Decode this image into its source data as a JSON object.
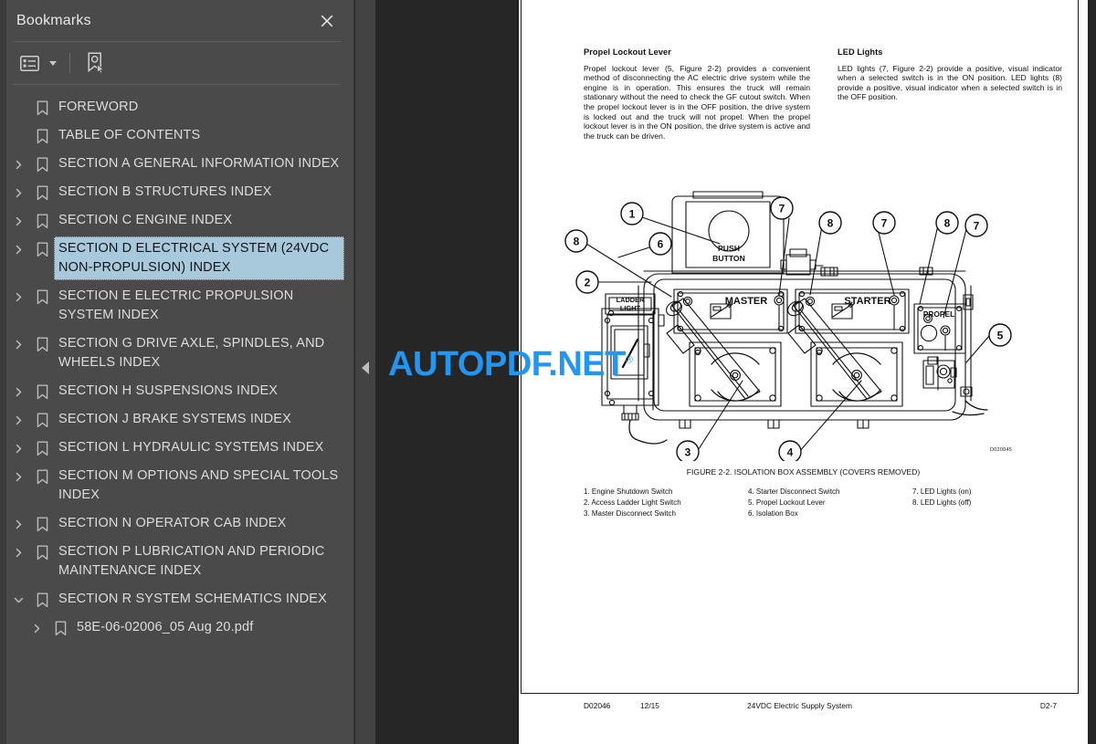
{
  "sidebar": {
    "title": "Bookmarks",
    "close_icon": "close-icon",
    "toolbar": {
      "options_icon": "list-options-icon",
      "dropdown_icon": "chevron-down-icon",
      "new_bookmark_icon": "new-bookmark-icon"
    },
    "items": [
      {
        "label": "FOREWORD",
        "twisty": "none",
        "depth": 0,
        "selected": false
      },
      {
        "label": "TABLE OF CONTENTS",
        "twisty": "none",
        "depth": 0,
        "selected": false
      },
      {
        "label": "SECTION A GENERAL INFORMATION INDEX",
        "twisty": "collapsed",
        "depth": 0,
        "selected": false
      },
      {
        "label": "SECTION B STRUCTURES INDEX",
        "twisty": "collapsed",
        "depth": 0,
        "selected": false
      },
      {
        "label": "SECTION C ENGINE INDEX",
        "twisty": "collapsed",
        "depth": 0,
        "selected": false
      },
      {
        "label": "SECTION D ELECTRICAL SYSTEM (24VDC NON-PROPULSION) INDEX",
        "twisty": "collapsed",
        "depth": 0,
        "selected": true
      },
      {
        "label": "SECTION E ELECTRIC PROPULSION SYSTEM INDEX",
        "twisty": "collapsed",
        "depth": 0,
        "selected": false
      },
      {
        "label": "SECTION G DRIVE AXLE, SPINDLES, AND WHEELS INDEX",
        "twisty": "collapsed",
        "depth": 0,
        "selected": false
      },
      {
        "label": "SECTION H SUSPENSIONS INDEX",
        "twisty": "collapsed",
        "depth": 0,
        "selected": false
      },
      {
        "label": "SECTION J BRAKE SYSTEMS INDEX",
        "twisty": "collapsed",
        "depth": 0,
        "selected": false
      },
      {
        "label": "SECTION L HYDRAULIC SYSTEMS INDEX",
        "twisty": "collapsed",
        "depth": 0,
        "selected": false
      },
      {
        "label": "SECTION M OPTIONS AND SPECIAL TOOLS INDEX",
        "twisty": "collapsed",
        "depth": 0,
        "selected": false
      },
      {
        "label": "SECTION N OPERATOR CAB INDEX",
        "twisty": "collapsed",
        "depth": 0,
        "selected": false
      },
      {
        "label": "SECTION P LUBRICATION AND PERIODIC MAINTENANCE INDEX",
        "twisty": "collapsed",
        "depth": 0,
        "selected": false
      },
      {
        "label": "SECTION R SYSTEM SCHEMATICS INDEX",
        "twisty": "expanded",
        "depth": 0,
        "selected": false
      },
      {
        "label": "58E-06-02006_05 Aug 20.pdf",
        "twisty": "collapsed",
        "depth": 1,
        "selected": false
      }
    ],
    "selection_color": "#a8c8dc"
  },
  "splitter": {
    "collapse_icon": "triangle-left-icon"
  },
  "watermark": {
    "text": "AUTOPDF.NET",
    "mark": "®",
    "color": "#2196f3"
  },
  "document": {
    "columns": [
      {
        "heading": "Propel Lockout Lever",
        "body": "Propel lockout lever (5, Figure 2-2) provides a convenient method of disconnecting the AC electric drive system while the engine is in operation. This ensures the truck will remain stationary without the need to check the GF cutout switch. When the propel lockout lever is in the OFF position, the drive system is locked out and the truck will not propel. When the propel lockout lever is in the ON position, the drive system is active and the truck can be driven."
      },
      {
        "heading": "LED Lights",
        "body": "LED lights (7, Figure 2-2) provide a positive, visual indicator when a selected switch is in the ON position. LED lights (8) provide a positive, visual indicator when a selected switch is in the OFF position."
      }
    ],
    "figure": {
      "caption": "FIGURE 2-2. ISOLATION BOX ASSEMBLY (COVERS REMOVED)",
      "drawing_id": "D020045",
      "labels": {
        "push_button": "PUSH\nBUTTON",
        "push_button_line1": "PUSH",
        "push_button_line2": "BUTTON",
        "ladder_light_line1": "LADDER",
        "ladder_light_line2": "LIGHT",
        "master": "MASTER",
        "starter": "STARTER",
        "propel": "PROPEL"
      },
      "callouts": [
        "1",
        "2",
        "3",
        "4",
        "5",
        "6",
        "7",
        "7",
        "7",
        "8",
        "8",
        "8"
      ],
      "legend": [
        [
          "1. Engine Shutdown Switch",
          "2. Access Ladder Light Switch",
          "3. Master Disconnect Switch"
        ],
        [
          "4. Starter Disconnect Switch",
          "5. Propel Lockout Lever",
          "6. Isolation Box"
        ],
        [
          "7. LED Lights (on)",
          "8. LED Lights (off)"
        ]
      ]
    },
    "footer": {
      "doc_id": "D02046",
      "revision": "12/15",
      "title": "24VDC Electric Supply System",
      "page_number": "D2-7"
    }
  }
}
